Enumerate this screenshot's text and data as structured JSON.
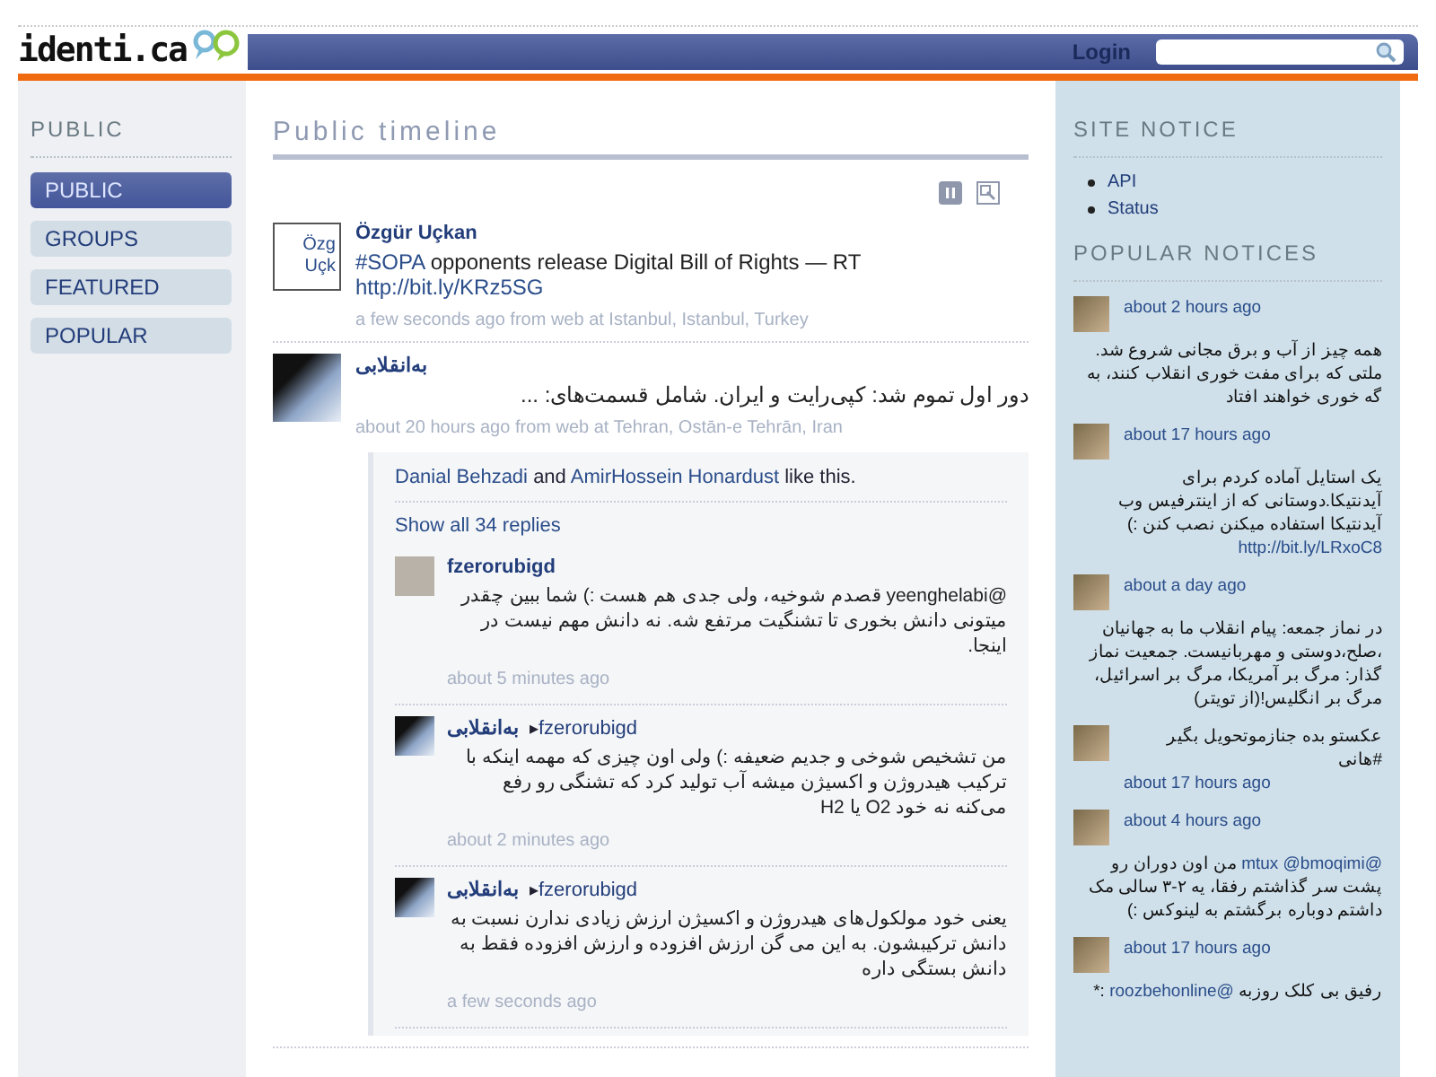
{
  "header": {
    "logo": "identi.ca",
    "login": "Login"
  },
  "sidebar": {
    "title": "PUBLIC",
    "items": [
      {
        "label": "PUBLIC",
        "selected": true
      },
      {
        "label": "GROUPS",
        "selected": false
      },
      {
        "label": "FEATURED",
        "selected": false
      },
      {
        "label": "POPULAR",
        "selected": false
      }
    ]
  },
  "main": {
    "title": "Public timeline",
    "notices": [
      {
        "author": "Özgür Uçkan",
        "avatar_alt": [
          "Özg",
          "Uçk"
        ],
        "rtl": false,
        "content": [
          {
            "kind": "link",
            "text": "#SOPA"
          },
          {
            "kind": "text",
            "text": "opponents release Digital Bill of Rights — RT"
          },
          {
            "kind": "link",
            "text": "http://bit.ly/KRz5SG"
          }
        ],
        "meta": "a few seconds ago from web at Istanbul, Istanbul, Turkey"
      },
      {
        "author": "به‌انقلابی",
        "rtl": true,
        "content": [
          {
            "kind": "text",
            "text": "دور اول تموم شد: کپی‌رایت و ایران. شامل قسمت‌های: ..."
          }
        ],
        "meta": "about 20 hours ago from web at Tehran, Ostān-e Tehrān, Iran",
        "conversation": {
          "likes": {
            "first_user": "Danial Behzadi",
            "conjunction": "and",
            "second_user": "AmirHossein Honardust",
            "suffix": "like this."
          },
          "show_all": "Show all 34 replies",
          "replies": [
            {
              "author": "fzerorubigd",
              "text": "@yeenghelabi قصدم شوخیه، ولی جدی هم هست :) شما ببین چقدر میتونی دانش بخوری تا تشنگیت مرتفع شه. نه دانش مهم نیست در اینجا.",
              "time": "about 5 minutes ago"
            },
            {
              "author": "به‌انقلابی",
              "to": "fzerorubigd",
              "arrow": "▸",
              "text": "من تشخیص شوخی و جدیم ضعیفه :) ولی اون چیزی که مهمه اینکه با ترکیب هیدروژن و اکسیژن میشه آب تولید کرد که تشنگی رو رفع می‌کنه نه خود O2 یا H2",
              "time": "about 2 minutes ago"
            },
            {
              "author": "به‌انقلابی",
              "to": "fzerorubigd",
              "arrow": "▸",
              "text": "یعنی خود مولکول‌های هیدروژن و اکسیژن ارزش زیادی ندارن نسبت به دانش ترکیبشون. به این می گن ارزش افزوده و ارزش افزوده فقط به دانش بستگی داره",
              "time": "a few seconds ago"
            }
          ]
        }
      }
    ]
  },
  "right": {
    "site_notice": {
      "title": "SITE NOTICE",
      "links": [
        "API",
        "Status"
      ]
    },
    "popular": {
      "title": "POPULAR NOTICES",
      "items": [
        {
          "kind": "time_first",
          "time": "about 2 hours ago",
          "content": [
            {
              "kind": "text",
              "text": "همه چیز از آب و برق مجانی شروع شد. ملتی که برای مفت خوری انقلاب کنند، به گه خوری خواهند افتاد"
            }
          ]
        },
        {
          "kind": "time_first",
          "time": "about 17 hours ago",
          "content": [
            {
              "kind": "text",
              "text": "یک استایل آماده کردم برای آیدنتیکا.دوستانی که از اینترفیس وب آیدنتیکا استفاده میکنن نصب کنن :)"
            },
            {
              "kind": "link",
              "text": "http://bit.ly/LRxoC8"
            }
          ]
        },
        {
          "kind": "time_first",
          "time": "about a day ago",
          "content": [
            {
              "kind": "text",
              "text": "در نماز جمعه: پیام انقلاب ما به جهانیان ،صلح،دوستی و مهربانیست. جمعیت نماز گذار: مرگ بر آمریکا، مرگ بر اسرائیل، مرگ بر انگلیس!(از تویتر)"
            }
          ]
        },
        {
          "kind": "text_first",
          "time": "about 17 hours ago",
          "content": [
            {
              "kind": "text",
              "text": "عکستو بده جنازموتحویل بگیر #هانی"
            }
          ]
        },
        {
          "kind": "time_first",
          "time": "about 4 hours ago",
          "content": [
            {
              "kind": "link",
              "text": "@mtux @bmoqimi"
            },
            {
              "kind": "text",
              "text": "من اون دوران رو پشت سر گذاشتم رفقا، یه ۲-۳ سالی مک داشتم دوباره برگشتم به لینوکس :)"
            }
          ]
        },
        {
          "kind": "time_first",
          "time": "about 17 hours ago",
          "content": [
            {
              "kind": "text",
              "text": "رفیق بی کلک روزبه"
            },
            {
              "kind": "link",
              "text": "@roozbehonline"
            },
            {
              "kind": "text",
              "text": ":*"
            }
          ]
        }
      ]
    }
  }
}
